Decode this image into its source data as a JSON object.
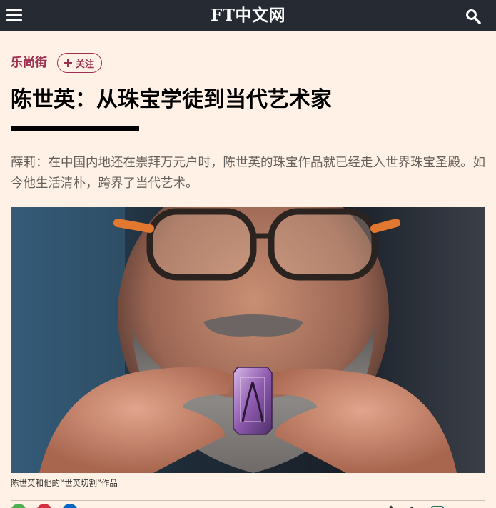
{
  "header": {
    "logo": "FT中文网",
    "menu_icon": "hamburger-menu-icon",
    "search_icon": "search-icon",
    "bg_color": "#262A33"
  },
  "article": {
    "channel": "乐尚街",
    "follow_label": "关注",
    "headline": "陈世英：从珠宝学徒到当代艺术家",
    "standfirst": "薛莉：在中国内地还在崇拜万元户时，陈世英的珠宝作品就已经走入世界珠宝圣殿。如今他生活清朴，跨界了当代艺术。",
    "photo_caption": "陈世英和他的“世英切割”作品",
    "accent_color": "#9E2F50",
    "background_color": "#FFF1E5"
  },
  "share_bar": {
    "icons": [
      "wechat-share-icon",
      "weibo-share-icon",
      "linkedin-share-icon"
    ],
    "tool_icons": [
      "font-size-icon",
      "save-icon",
      "comment-icon"
    ]
  }
}
